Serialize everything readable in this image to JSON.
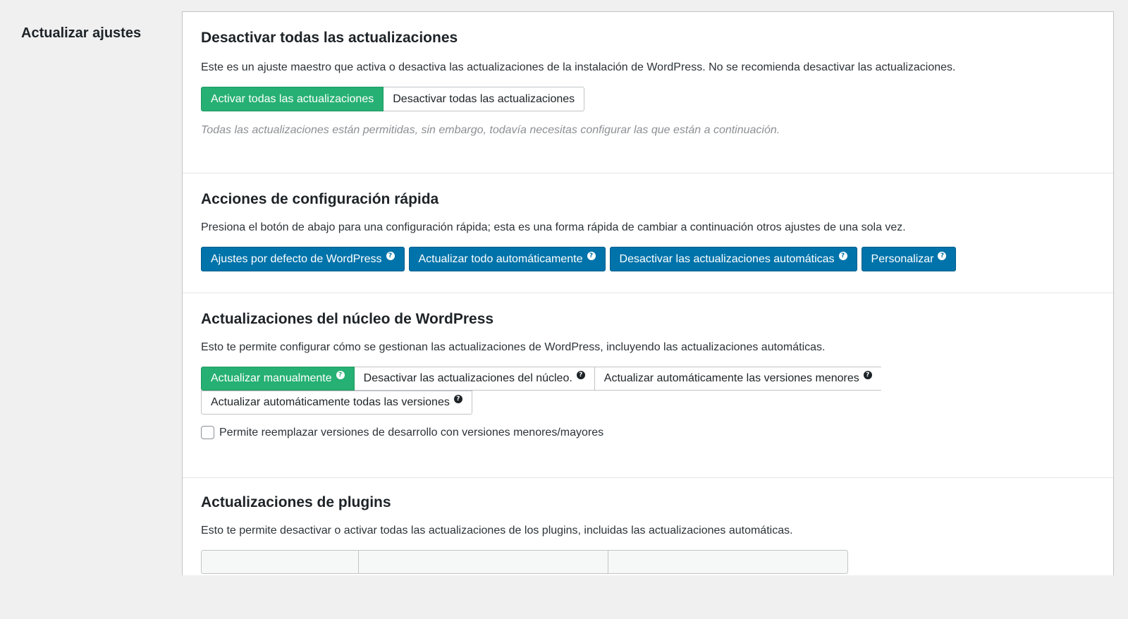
{
  "sidebar": {
    "title": "Actualizar ajustes"
  },
  "sections": {
    "disable_all": {
      "title": "Desactivar todas las actualizaciones",
      "description": "Este es un ajuste maestro que activa o desactiva las actualizaciones de la instalación de WordPress. No se recomienda desactivar las actualizaciones.",
      "options": [
        "Activar todas las actualizaciones",
        "Desactivar todas las actualizaciones"
      ],
      "selected": "Activar todas las actualizaciones",
      "note": "Todas las actualizaciones están permitidas, sin embargo, todavía necesitas configurar las que están a continuación."
    },
    "quick_config": {
      "title": "Acciones de configuración rápida",
      "description": "Presiona el botón de abajo para una configuración rápida; esta es una forma rápida de cambiar a continuación otros ajustes de una sola vez.",
      "buttons": [
        "Ajustes por defecto de WordPress",
        "Actualizar todo automáticamente",
        "Desactivar las actualizaciones automáticas",
        "Personalizar"
      ]
    },
    "core": {
      "title": "Actualizaciones del núcleo de WordPress",
      "description": "Esto te permite configurar cómo se gestionan las actualizaciones de WordPress, incluyendo las actualizaciones automáticas.",
      "options": [
        "Actualizar manualmente",
        "Desactivar las actualizaciones del núcleo.",
        "Actualizar automáticamente las versiones menores",
        "Actualizar automáticamente todas las versiones"
      ],
      "selected": "Actualizar manualmente",
      "checkbox_label": "Permite reemplazar versiones de desarrollo con versiones menores/mayores",
      "checkbox_checked": false
    },
    "plugins": {
      "title": "Actualizaciones de plugins",
      "description": "Esto te permite desactivar o activar todas las actualizaciones de los plugins, incluidas las actualizaciones automáticas."
    }
  },
  "colors": {
    "active": "#26b073",
    "primary": "#0073aa",
    "background": "#f0f0f1"
  },
  "icons": {
    "help": "question-circle-icon"
  }
}
